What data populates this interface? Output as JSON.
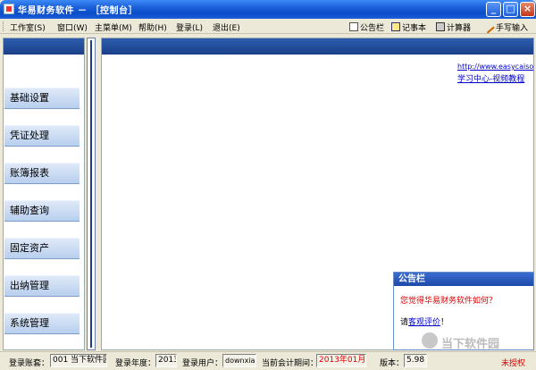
{
  "window": {
    "title": "华易财务软件 － ［控制台］",
    "controls": [
      "_",
      "□",
      "×"
    ]
  },
  "menu": {
    "items": [
      "工作室(S)",
      "窗口(W)",
      "主菜单(M)",
      "帮助(H)",
      "登录(L)",
      "退出(E)"
    ],
    "tools": [
      "公告栏",
      "记事本",
      "计算器",
      "手写输入"
    ]
  },
  "nav": {
    "items": [
      "基础设置",
      "凭证处理",
      "账簿报表",
      "辅助查询",
      "固定资产",
      "出纳管理",
      "系统管理"
    ]
  },
  "main": {
    "url_link": "http://www.easycaiso",
    "video_link": "学习中心-视频教程"
  },
  "notice": {
    "title": "公告栏",
    "question": "您觉得华易财务软件如何？",
    "prefix": "请",
    "link": "客观评价",
    "suffix": "！"
  },
  "watermark": {
    "text": "当下软件园",
    "sub": "downxia"
  },
  "status": {
    "account_label": "登录账套：",
    "account_value": "001 当下软件园",
    "year_label": "登录年度：",
    "year_value": "2013",
    "user_label": "登录用户：",
    "user_value": "downxia",
    "period_label": "当前会计期间：",
    "period_value": "2013年01月",
    "version_label": "版本：",
    "version_value": "5.98",
    "license_value": "未授权"
  },
  "colors": {
    "title_bar": "#1a5fd8",
    "pane_header": "#1a3f88",
    "nav_button": "#b8cfee",
    "link": "#0000cc",
    "alert": "#dd0000"
  }
}
